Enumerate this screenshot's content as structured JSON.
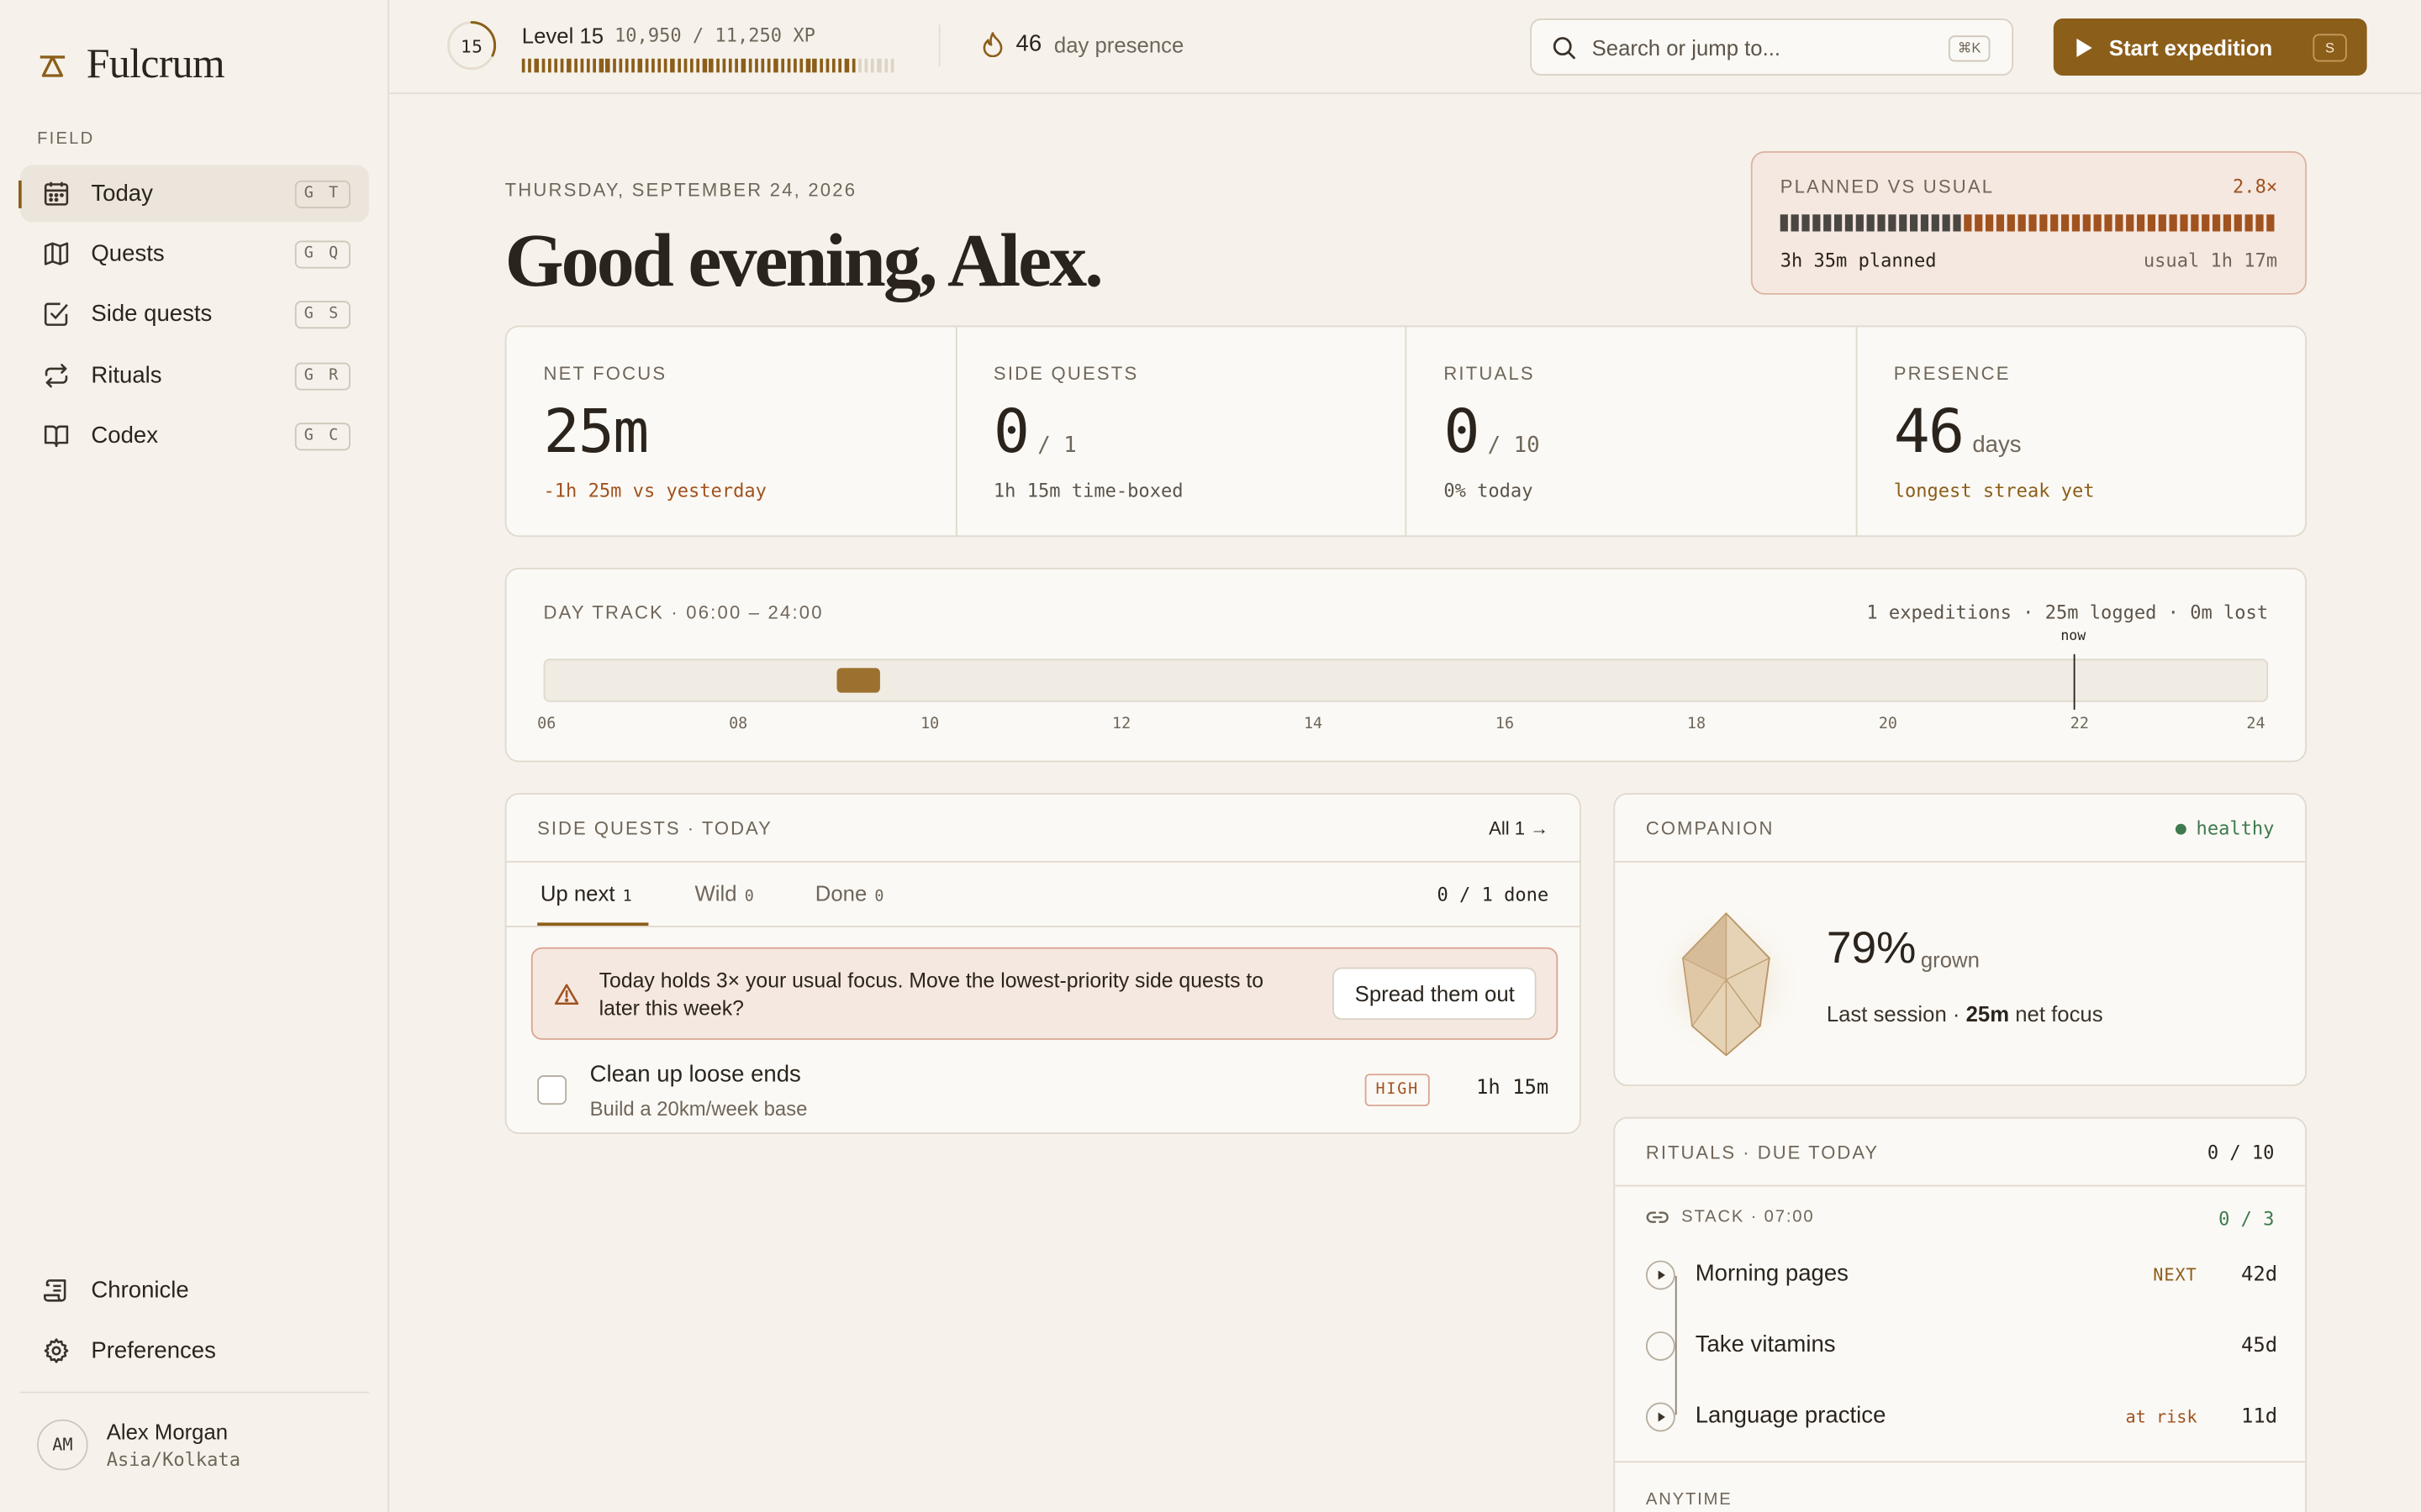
{
  "app": {
    "name": "Fulcrum"
  },
  "sidebar": {
    "section": "FIELD",
    "items": [
      {
        "label": "Today",
        "shortcut": "G T",
        "icon": "calendar-icon",
        "active": true
      },
      {
        "label": "Quests",
        "shortcut": "G Q",
        "icon": "map-icon"
      },
      {
        "label": "Side quests",
        "shortcut": "G S",
        "icon": "checkbox-icon"
      },
      {
        "label": "Rituals",
        "shortcut": "G R",
        "icon": "repeat-icon"
      },
      {
        "label": "Codex",
        "shortcut": "G C",
        "icon": "book-icon"
      }
    ],
    "bottom_items": [
      {
        "label": "Chronicle",
        "icon": "scroll-icon"
      },
      {
        "label": "Preferences",
        "icon": "gear-icon"
      }
    ],
    "user": {
      "initials": "AM",
      "name": "Alex Morgan",
      "timezone": "Asia/Kolkata"
    }
  },
  "topbar": {
    "level_number": "15",
    "level_label": "Level 15",
    "xp_text": "10,950 / 11,250 XP",
    "xp_fraction": 0.973,
    "presence_count": "46",
    "presence_label": "day presence",
    "search_placeholder": "Search or jump to...",
    "search_shortcut": "⌘K",
    "start_label": "Start expedition",
    "start_shortcut": "S"
  },
  "header": {
    "date": "THURSDAY, SEPTEMBER 24, 2026",
    "greeting": "Good evening, Alex."
  },
  "planned_vs_usual": {
    "title": "PLANNED VS USUAL",
    "multiplier": "2.8×",
    "planned": "3h 35m planned",
    "usual": "usual 1h 17m",
    "usual_fraction": 0.36
  },
  "stats": [
    {
      "label": "NET FOCUS",
      "value": "25m",
      "suffix": "",
      "sub": "-1h 25m vs yesterday",
      "tone": "warn"
    },
    {
      "label": "SIDE QUESTS",
      "value": "0",
      "suffix": "/ 1",
      "sub": "1h 15m time-boxed",
      "tone": ""
    },
    {
      "label": "RITUALS",
      "value": "0",
      "suffix": "/ 10",
      "sub": "0% today",
      "tone": ""
    },
    {
      "label": "PRESENCE",
      "value": "46",
      "suffix": "days",
      "sub": "longest streak yet",
      "tone": "accent"
    }
  ],
  "day_track": {
    "title": "DAY TRACK · 06:00 – 24:00",
    "meta": "1 expeditions · 25m logged · 0m lost",
    "range": [
      6,
      24
    ],
    "ticks": [
      "06",
      "08",
      "10",
      "12",
      "14",
      "16",
      "18",
      "20",
      "22",
      "24"
    ],
    "sessions": [
      {
        "start": 9.05,
        "end": 9.5
      }
    ],
    "now": 21.95,
    "now_label": "now"
  },
  "side_quests": {
    "title": "SIDE QUESTS · TODAY",
    "all_link": "All 1 →",
    "tabs": [
      {
        "label": "Up next",
        "count": "1"
      },
      {
        "label": "Wild",
        "count": "0"
      },
      {
        "label": "Done",
        "count": "0"
      }
    ],
    "done_text": "0 / 1 done",
    "banner_text": "Today holds 3× your usual focus. Move the lowest-priority side quests to later this week?",
    "banner_button": "Spread them out",
    "tasks": [
      {
        "title": "Clean up loose ends",
        "subtitle": "Build a 20km/week base",
        "priority": "HIGH",
        "duration": "1h 15m"
      }
    ]
  },
  "companion": {
    "title": "COMPANION",
    "status": "healthy",
    "percent": "79%",
    "percent_label": "grown",
    "last_prefix": "Last session · ",
    "last_value": "25m",
    "last_suffix": " net focus"
  },
  "rituals": {
    "title": "RITUALS · DUE TODAY",
    "count": "0 / 10",
    "stack_title": "STACK · 07:00",
    "stack_count": "0 / 3",
    "items": [
      {
        "name": "Morning pages",
        "tag": "NEXT",
        "days": "42d"
      },
      {
        "name": "Take vitamins",
        "tag": "",
        "days": "45d"
      },
      {
        "name": "Language practice",
        "tag": "at risk",
        "days": "11d"
      }
    ],
    "anytime_title": "ANYTIME"
  },
  "colors": {
    "accent": "#8b5e1a",
    "warn": "#a0521f",
    "healthy": "#3e7a4e",
    "background": "#f6f2eb"
  }
}
